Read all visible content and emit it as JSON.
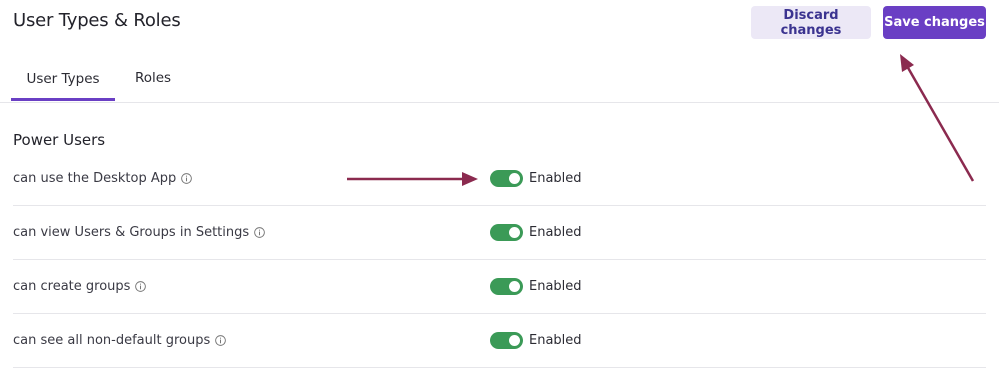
{
  "header": {
    "title": "User Types & Roles",
    "discard_label": "Discard changes",
    "save_label": "Save changes"
  },
  "tabs": [
    {
      "label": "User Types",
      "active": true
    },
    {
      "label": "Roles",
      "active": false
    }
  ],
  "section": {
    "title": "Power Users",
    "permissions": [
      {
        "label": "can use the Desktop App",
        "icon": "info-icon",
        "enabled": true,
        "status": "Enabled"
      },
      {
        "label": "can view Users & Groups in Settings",
        "icon": "info-icon",
        "enabled": true,
        "status": "Enabled"
      },
      {
        "label": "can create groups",
        "icon": "info-icon",
        "enabled": true,
        "status": "Enabled"
      },
      {
        "label": "can see all non-default groups",
        "icon": "info-icon",
        "enabled": true,
        "status": "Enabled"
      }
    ]
  },
  "colors": {
    "accent": "#6a3fc4",
    "toggle_on": "#3b9a57",
    "annotation_arrow": "#8b2a4f"
  }
}
